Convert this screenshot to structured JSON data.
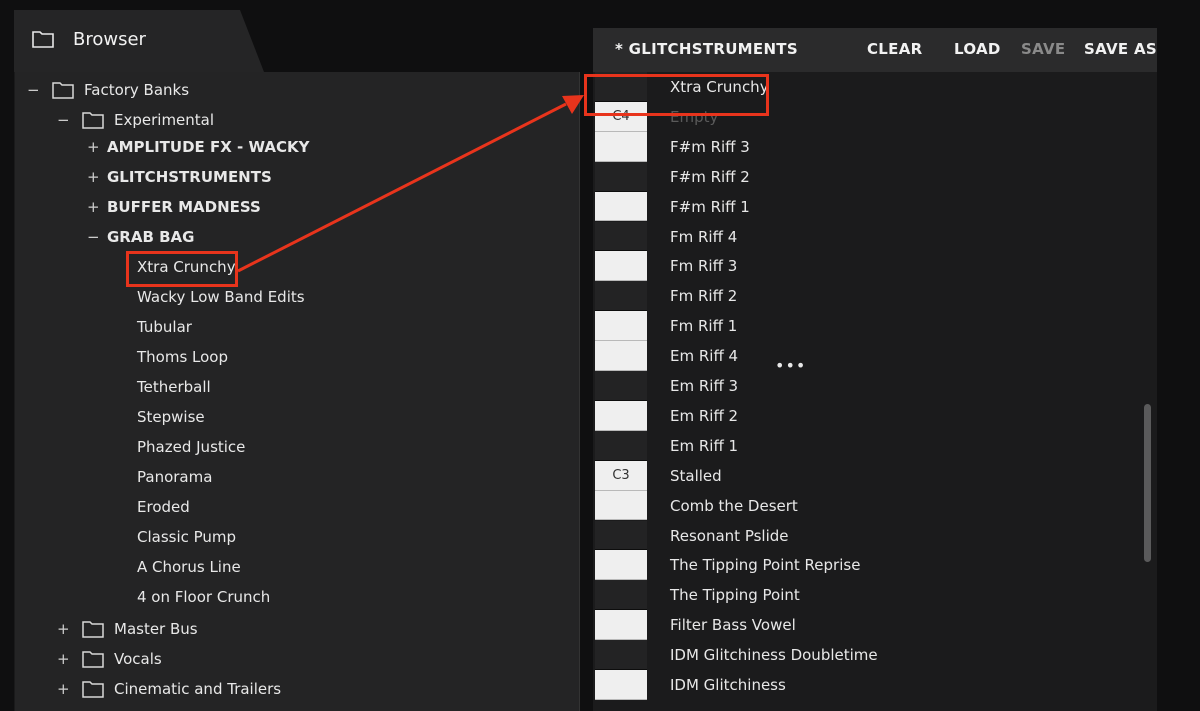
{
  "browser": {
    "title": "Browser",
    "tree": [
      {
        "label": "Factory Banks",
        "expander": "−",
        "icon": "folder-icon",
        "bold": false
      },
      {
        "label": "Experimental",
        "expander": "−",
        "icon": "folder-icon",
        "bold": false
      },
      {
        "label": "AMPLITUDE FX - WACKY",
        "expander": "+",
        "bold": true
      },
      {
        "label": "GLITCHSTRUMENTS",
        "expander": "+",
        "bold": true
      },
      {
        "label": "BUFFER MADNESS",
        "expander": "+",
        "bold": true
      },
      {
        "label": "GRAB BAG",
        "expander": "−",
        "bold": true
      },
      {
        "label": "Xtra Crunchy",
        "highlighted": true
      },
      {
        "label": "Wacky Low Band Edits"
      },
      {
        "label": "Tubular"
      },
      {
        "label": "Thoms Loop"
      },
      {
        "label": "Tetherball"
      },
      {
        "label": "Stepwise"
      },
      {
        "label": "Phazed Justice"
      },
      {
        "label": "Panorama"
      },
      {
        "label": "Eroded"
      },
      {
        "label": "Classic Pump"
      },
      {
        "label": "A Chorus Line"
      },
      {
        "label": "4 on Floor Crunch"
      },
      {
        "label": "Master Bus",
        "expander": "+",
        "icon": "folder-icon"
      },
      {
        "label": "Vocals",
        "expander": "+",
        "icon": "folder-icon"
      },
      {
        "label": "Cinematic and Trailers",
        "expander": "+",
        "icon": "folder-icon"
      }
    ]
  },
  "bank": {
    "title": "* GLITCHSTRUMENTS",
    "buttons": {
      "clear": "CLEAR",
      "load": "LOAD",
      "save": "SAVE",
      "save_as": "SAVE AS"
    },
    "save_disabled": true,
    "slots": [
      {
        "label": "Xtra Crunchy",
        "highlighted": true
      },
      {
        "label": "Empty",
        "empty": true,
        "key_label": "C4"
      },
      {
        "label": "F#m Riff 3"
      },
      {
        "label": "F#m Riff 2"
      },
      {
        "label": "F#m Riff 1"
      },
      {
        "label": "Fm Riff 4"
      },
      {
        "label": "Fm Riff 3"
      },
      {
        "label": "Fm Riff 2"
      },
      {
        "label": "Fm Riff 1"
      },
      {
        "label": "Em Riff 4"
      },
      {
        "label": "Em Riff 3"
      },
      {
        "label": "Em Riff 2"
      },
      {
        "label": "Em Riff 1"
      },
      {
        "label": "Stalled",
        "key_label": "C3"
      },
      {
        "label": "Comb the Desert"
      },
      {
        "label": "Resonant Pslide"
      },
      {
        "label": "The Tipping Point Reprise"
      },
      {
        "label": "The Tipping Point"
      },
      {
        "label": "Filter Bass Vowel"
      },
      {
        "label": "IDM Glitchiness Doubletime"
      },
      {
        "label": "IDM Glitchiness"
      }
    ],
    "more_menu": "•••"
  },
  "colors": {
    "highlight": "#e8341c",
    "panel": "#242425",
    "toolbar": "#2b2b2c"
  }
}
